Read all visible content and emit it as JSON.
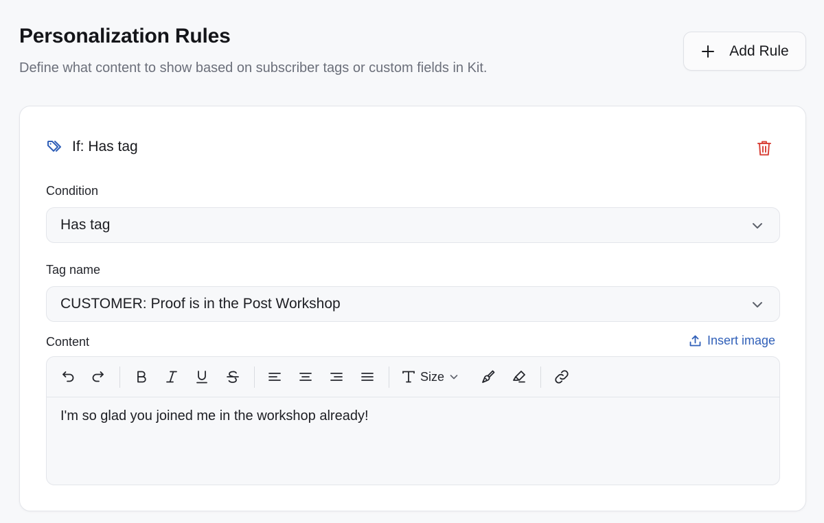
{
  "header": {
    "title": "Personalization Rules",
    "subtitle": "Define what content to show based on subscriber tags or custom fields in Kit.",
    "add_rule_label": "Add Rule"
  },
  "rule": {
    "title": "If: Has tag",
    "condition_label": "Condition",
    "condition_value": "Has tag",
    "tag_label": "Tag name",
    "tag_value": "CUSTOMER: Proof is in the Post Workshop",
    "content_label": "Content",
    "insert_image_label": "Insert image",
    "content_text": "I'm so glad you joined me in the workshop already!"
  },
  "toolbar": {
    "size_label": "Size",
    "buttons": [
      "undo-icon",
      "redo-icon",
      "bold-icon",
      "italic-icon",
      "underline-icon",
      "strikethrough-icon",
      "align-left-icon",
      "align-center-icon",
      "align-right-icon",
      "align-justify-icon",
      "text-size-icon",
      "text-color-icon",
      "highlight-icon",
      "link-icon"
    ]
  },
  "colors": {
    "accent": "#2f5fb8",
    "danger": "#d9443b",
    "background": "#f7f8fa",
    "card": "#ffffff"
  }
}
